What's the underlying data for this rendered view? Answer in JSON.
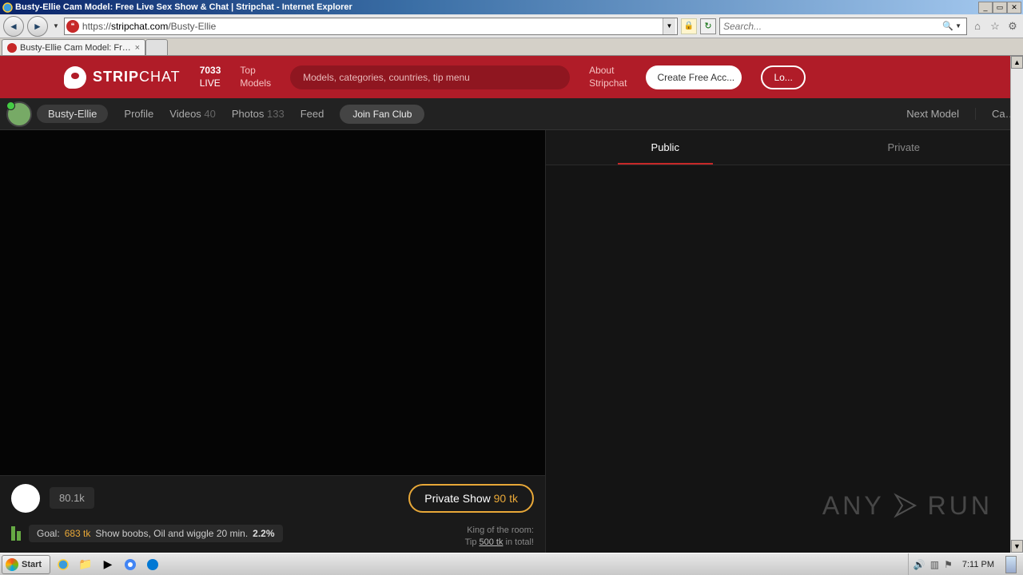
{
  "window": {
    "title": "Busty-Ellie Cam Model: Free Live Sex Show & Chat | Stripchat - Internet Explorer",
    "min": "_",
    "max": "▭",
    "close": "✕"
  },
  "browser": {
    "url_prefix": "https://",
    "url_domain": "stripchat.com",
    "url_path": "/Busty-Ellie",
    "search_placeholder": "Search...",
    "tab_title": "Busty-Ellie Cam Model: Free …"
  },
  "site": {
    "logo_a": "STRIP",
    "logo_b": "CHAT",
    "live_count": "7033",
    "live_label": "LIVE",
    "top_models_a": "Top",
    "top_models_b": "Models",
    "search_hint": "Models, categories, countries, tip menu",
    "about_a": "About",
    "about_b": "Stripchat",
    "create_btn": "Create Free Acc...",
    "login_btn": "Lo..."
  },
  "profile": {
    "name": "Busty-Ellie",
    "links": {
      "profile": "Profile",
      "videos": "Videos",
      "videos_count": "40",
      "photos": "Photos",
      "photos_count": "133",
      "feed": "Feed"
    },
    "fan_club": "Join Fan Club",
    "next_model": "Next Model",
    "categories": "Cate..."
  },
  "video_bar": {
    "followers": "80.1k",
    "private_label": "Private Show",
    "private_price": "90 tk"
  },
  "goal": {
    "prefix": "Goal:",
    "tk": "683 tk",
    "text": "Show boobs, Oil and wiggle 20 min.",
    "pct": "2.2%"
  },
  "king": {
    "line1": "King of the room:",
    "line2a": "Tip ",
    "line2b": "500 tk",
    "line2c": " in total!"
  },
  "chat": {
    "public": "Public",
    "private": "Private"
  },
  "watermark": {
    "a": "ANY",
    "b": "RUN"
  },
  "taskbar": {
    "start": "Start",
    "clock": "7:11 PM"
  }
}
